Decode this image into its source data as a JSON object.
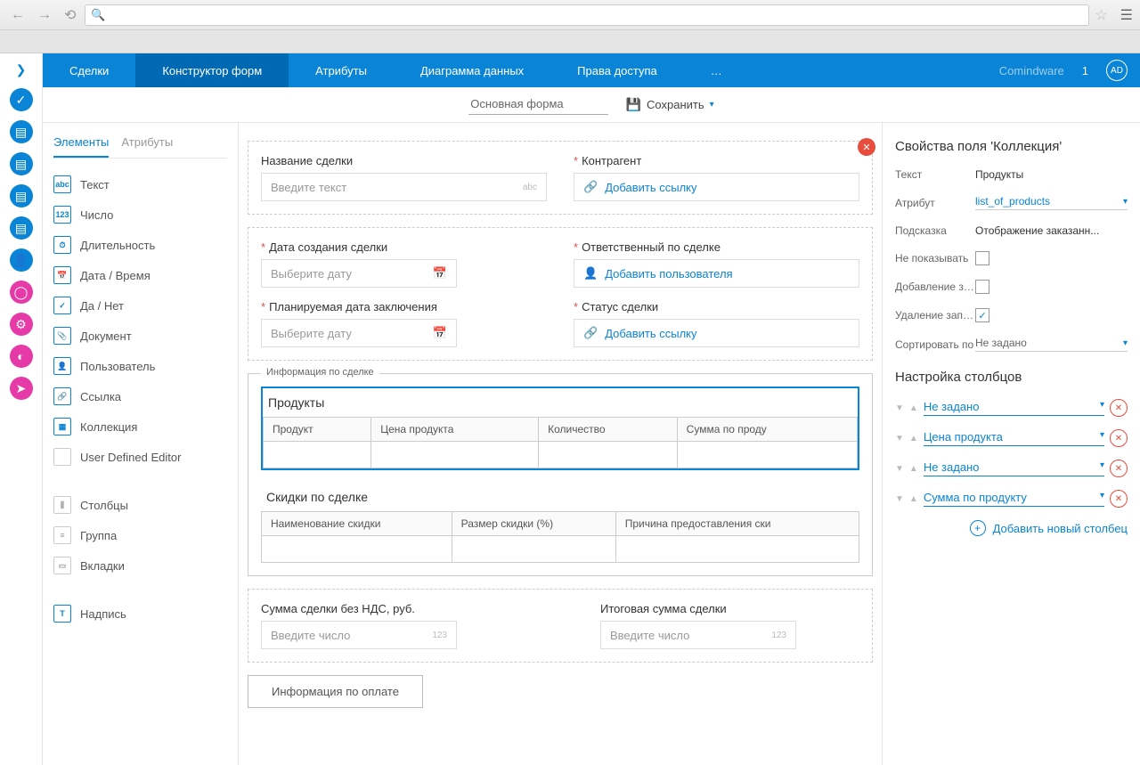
{
  "topTabs": {
    "t1": "Сделки",
    "t2": "Конструктор форм",
    "t3": "Атрибуты",
    "t4": "Диаграмма данных",
    "t5": "Права доступа",
    "more": "…"
  },
  "user": {
    "name": "Comindware",
    "count": "1",
    "avatar": "AD"
  },
  "subheader": {
    "formName": "Основная форма",
    "save": "Сохранить"
  },
  "palette": {
    "tabElements": "Элементы",
    "tabAttributes": "Атрибуты",
    "items": {
      "text": "Текст",
      "number": "Число",
      "duration": "Длительность",
      "datetime": "Дата / Время",
      "yesno": "Да / Нет",
      "document": "Документ",
      "user": "Пользователь",
      "link": "Ссылка",
      "collection": "Коллекция",
      "ude": "User Defined Editor",
      "columns": "Столбцы",
      "group": "Группа",
      "tabs": "Вкладки",
      "label": "Надпись"
    },
    "icons": {
      "text": "abc",
      "number": "123",
      "duration": "⏱",
      "datetime": "📅",
      "yesno": "✓",
      "document": "📎",
      "user": "👤",
      "link": "🔗",
      "collection": "▦",
      "ude": "",
      "columns": "⫼",
      "group": "≡",
      "tabs": "▭",
      "label": "T"
    }
  },
  "canvas": {
    "dealName": {
      "label": "Название сделки",
      "placeholder": "Введите текст",
      "suffix": "abc"
    },
    "counterparty": {
      "label": "Контрагент",
      "placeholder": "Добавить ссылку"
    },
    "createDate": {
      "label": "Дата создания сделки",
      "placeholder": "Выберите дату"
    },
    "responsible": {
      "label": "Ответственный по сделке",
      "placeholder": "Добавить пользователя"
    },
    "plannedDate": {
      "label": "Планируемая дата заключения",
      "placeholder": "Выберите дату"
    },
    "status": {
      "label": "Статус сделки",
      "placeholder": "Добавить ссылку"
    },
    "infoLegend": "Информация по сделке",
    "productsTitle": "Продукты",
    "productCols": {
      "c1": "Продукт",
      "c2": "Цена продукта",
      "c3": "Количество",
      "c4": "Сумма по проду"
    },
    "discountsTitle": "Скидки по сделке",
    "discountCols": {
      "c1": "Наименование скидки",
      "c2": "Размер скидки (%)",
      "c3": "Причина предоставления ски"
    },
    "sumNoVat": {
      "label": "Сумма сделки без НДС, руб.",
      "placeholder": "Введите число",
      "suffix": "123"
    },
    "totalSum": {
      "label": "Итоговая сумма сделки",
      "placeholder": "Введите число",
      "suffix": "123"
    },
    "paymentInfo": "Информация по оплате"
  },
  "props": {
    "title": "Свойства поля 'Коллекция'",
    "textLabel": "Текст",
    "textValue": "Продукты",
    "attrLabel": "Атрибут",
    "attrValue": "list_of_products",
    "hintLabel": "Подсказка",
    "hintValue": "Отображение заказанн...",
    "hideLabel": "Не показывать",
    "addLabel": "Добавление за...",
    "deleteLabel": "Удаление запи...",
    "sortLabel": "Сортировать по",
    "sortValue": "Не задано",
    "colsTitle": "Настройка столбцов",
    "cols": {
      "c1": "Не задано",
      "c2": "Цена продукта",
      "c3": "Не задано",
      "c4": "Сумма по продукту"
    },
    "addColumn": "Добавить новый столбец"
  }
}
